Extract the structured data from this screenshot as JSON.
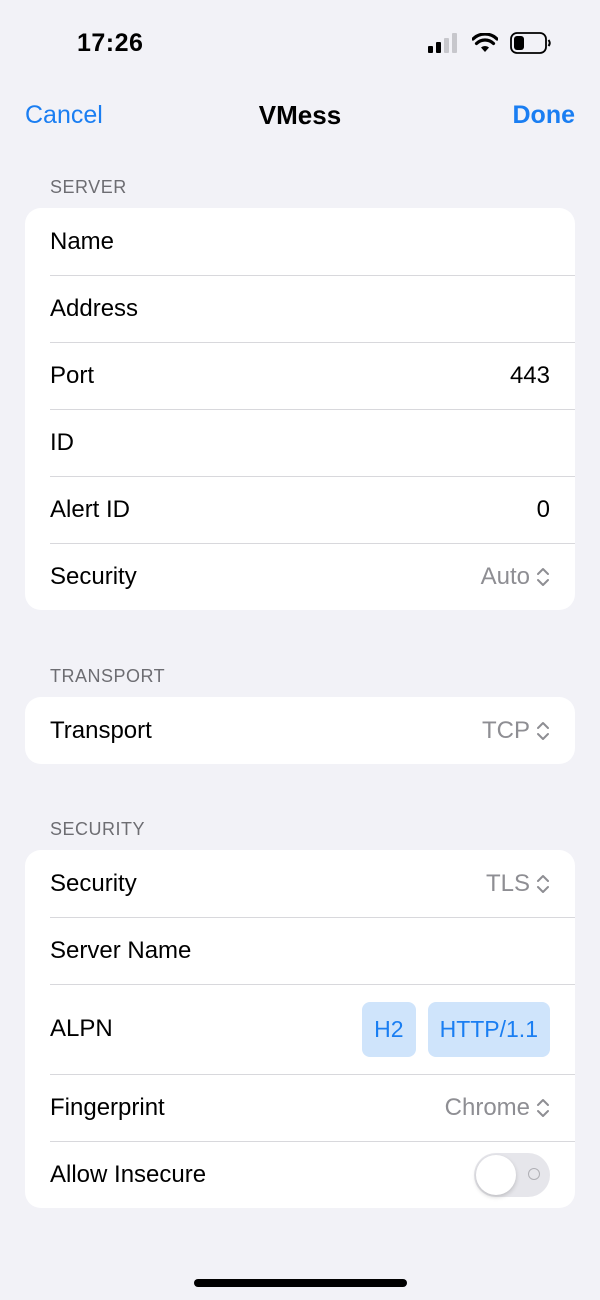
{
  "status_bar": {
    "time": "17:26",
    "icons": [
      "signal-icon",
      "wifi-icon",
      "battery-icon"
    ]
  },
  "nav": {
    "cancel_label": "Cancel",
    "title": "VMess",
    "done_label": "Done"
  },
  "server": {
    "header": "SERVER",
    "name_label": "Name",
    "address_label": "Address",
    "port_label": "Port",
    "port_value": "443",
    "id_label": "ID",
    "alert_id_label": "Alert ID",
    "alert_id_value": "0",
    "security_label": "Security",
    "security_value": "Auto"
  },
  "transport": {
    "header": "TRANSPORT",
    "transport_label": "Transport",
    "transport_value": "TCP"
  },
  "security": {
    "header": "SECURITY",
    "security_label": "Security",
    "security_value": "TLS",
    "server_name_label": "Server Name",
    "alpn_label": "ALPN",
    "alpn_options": [
      "H2",
      "HTTP/1.1"
    ],
    "fingerprint_label": "Fingerprint",
    "fingerprint_value": "Chrome",
    "allow_insecure_label": "Allow Insecure",
    "allow_insecure_on": false
  },
  "colors": {
    "accent": "#1a7ef2",
    "background": "#f2f2f7",
    "chip_bg": "#cfe4fb",
    "secondary_text": "#8e8e93"
  }
}
